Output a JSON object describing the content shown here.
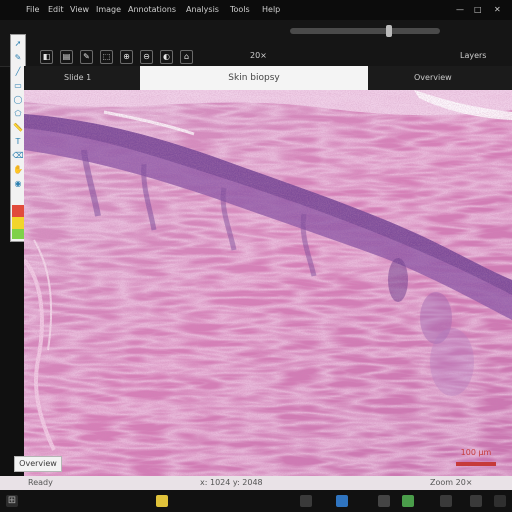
{
  "menubar": {
    "items": [
      {
        "label": "File"
      },
      {
        "label": "Edit"
      },
      {
        "label": "View"
      },
      {
        "label": "Image"
      },
      {
        "label": "Annotations"
      },
      {
        "label": "Analysis"
      },
      {
        "label": "Tools"
      },
      {
        "label": "Help"
      }
    ]
  },
  "toolbar": {
    "buttons": [
      {
        "glyph": "◧"
      },
      {
        "glyph": "▤"
      },
      {
        "glyph": "✎"
      },
      {
        "glyph": "⬚"
      },
      {
        "glyph": "⊕"
      },
      {
        "glyph": "⊖"
      },
      {
        "glyph": "◐"
      },
      {
        "glyph": "⌂"
      }
    ],
    "magnification_label": "20×",
    "right_label": "Layers"
  },
  "tabs": [
    {
      "label": "Slide 1"
    },
    {
      "label": "Skin biopsy"
    },
    {
      "label": "Overview"
    }
  ],
  "viewer": {
    "overview_label": "Overview",
    "scale_label": "100 µm"
  },
  "statusbar": {
    "left": "Ready",
    "center": "x: 1024  y: 2048",
    "right": "Zoom 20×"
  },
  "colors": {
    "tissue_pink": "#d780b7",
    "epidermis_purple": "#8f5ba8",
    "scale_red": "#c63a3a"
  },
  "icons": [
    "folder-icon",
    "grid-icon",
    "pen-icon",
    "select-icon",
    "zoom-in-icon",
    "zoom-out-icon",
    "contrast-icon",
    "home-icon"
  ]
}
